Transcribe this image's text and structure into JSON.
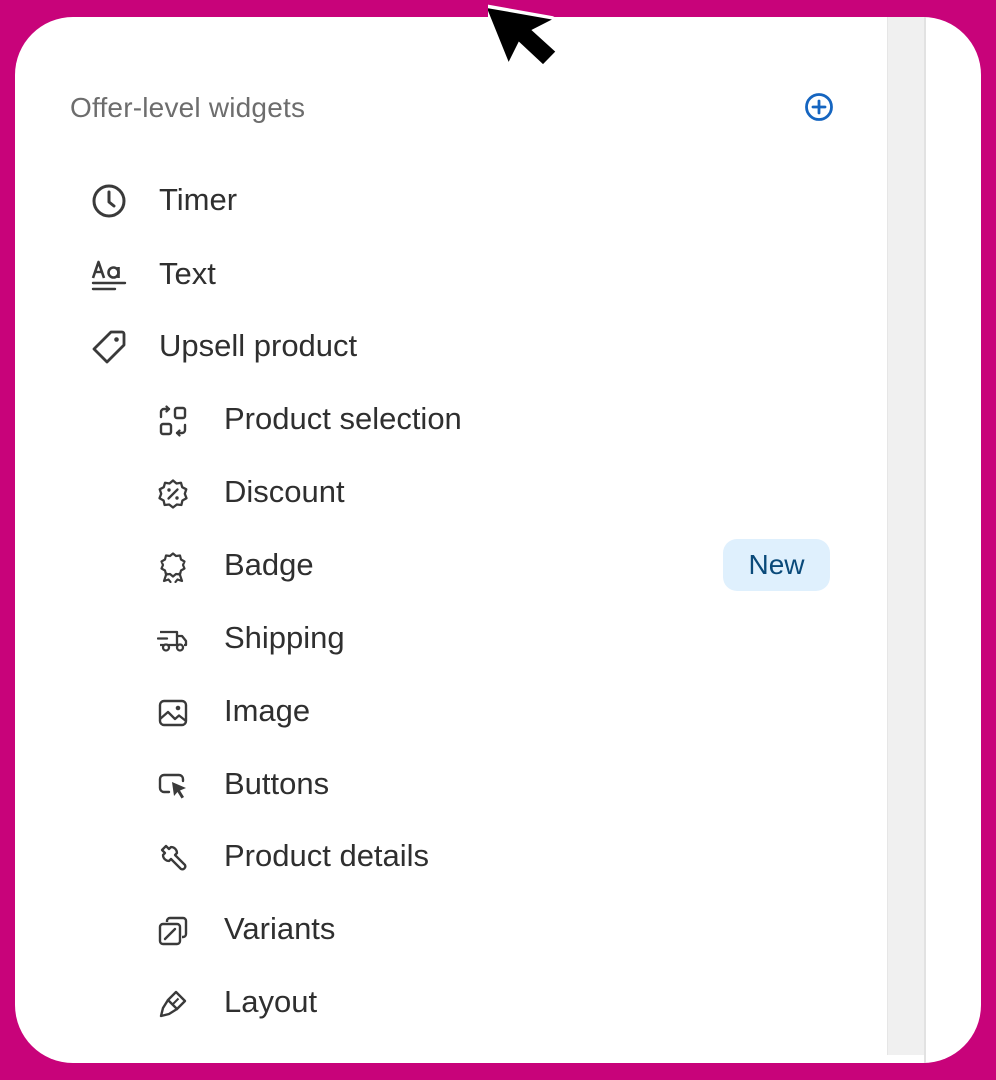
{
  "section": {
    "title": "Offer-level widgets",
    "add_icon": "add-circle-icon",
    "accent_color": "#1565c0"
  },
  "items": [
    {
      "label": "Timer",
      "icon": "clock-icon",
      "level": 1
    },
    {
      "label": "Text",
      "icon": "text-format-icon",
      "level": 1
    },
    {
      "label": "Upsell product",
      "icon": "tag-icon",
      "level": 1
    },
    {
      "label": "Product selection",
      "icon": "swap-icon",
      "level": 2
    },
    {
      "label": "Discount",
      "icon": "discount-icon",
      "level": 2
    },
    {
      "label": "Badge",
      "icon": "badge-icon",
      "level": 2,
      "badge": "New"
    },
    {
      "label": "Shipping",
      "icon": "truck-icon",
      "level": 2
    },
    {
      "label": "Image",
      "icon": "image-icon",
      "level": 2
    },
    {
      "label": "Buttons",
      "icon": "cursor-click-icon",
      "level": 2
    },
    {
      "label": "Product details",
      "icon": "wrench-icon",
      "level": 2
    },
    {
      "label": "Variants",
      "icon": "variants-icon",
      "level": 2
    },
    {
      "label": "Layout",
      "icon": "paint-brush-icon",
      "level": 2
    }
  ],
  "colors": {
    "frame": "#c8037a",
    "badge_bg": "#dff0fd",
    "badge_text": "#0a4a7a"
  }
}
